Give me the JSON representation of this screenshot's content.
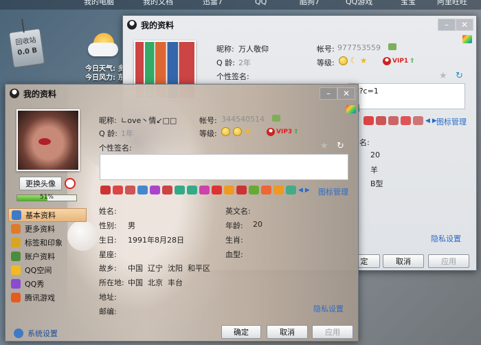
{
  "desktop": {
    "top_items": [
      "我的电脑",
      "我的文档",
      "迅雷7",
      "QQ",
      "酷狗7",
      "QQ游戏",
      "宝宝",
      "阿里旺旺"
    ],
    "trash_label": "回收站",
    "trash_size": "0.0 B",
    "weather_today_label": "今日天气:",
    "weather_today_value": "多",
    "weather_wind_label": "今日风力:",
    "weather_wind_value": "东"
  },
  "back_window": {
    "title": "我的资料",
    "nickname_label": "昵称:",
    "nickname_value": "万人敬仰",
    "account_label": "帐号:",
    "account_value": "977753559",
    "qage_label": "Q 龄:",
    "qage_value": "2年",
    "level_label": "等级:",
    "vip_text": "VIP1",
    "signature_label": "个性签名:",
    "signature_value": "m?c=1",
    "icon_manage": "图标管理",
    "name_label": "名:",
    "age_value": "20",
    "zodiac_value": "羊",
    "blood_value": "B型",
    "privacy": "隐私设置",
    "ok": "定",
    "cancel": "取消",
    "apply": "应用"
  },
  "front_window": {
    "title": "我的资料",
    "change_avatar": "更换头像",
    "progress_percent": 51,
    "progress_text": "51%",
    "nickname_label": "昵称:",
    "nickname_value": "∟ove丶情↙□□",
    "account_label": "帐号:",
    "account_value": "344540514",
    "qage_label": "Q 龄:",
    "qage_value": "1年",
    "level_label": "等级:",
    "vip_text": "VIP3",
    "signature_label": "个性签名:",
    "icon_manage": "图标管理",
    "sidebar": [
      {
        "label": "基本资料",
        "icon": "profile-card-icon",
        "color": "#3f7ac8",
        "active": true
      },
      {
        "label": "更多资料",
        "icon": "more-info-icon",
        "color": "#e07a2a",
        "active": false
      },
      {
        "label": "标签和印象",
        "icon": "tag-icon",
        "color": "#d9a421",
        "active": false
      },
      {
        "label": "账户资料",
        "icon": "account-icon",
        "color": "#4b8d3f",
        "active": false
      },
      {
        "label": "QQ空间",
        "icon": "qzone-icon",
        "color": "#f2b922",
        "active": false
      },
      {
        "label": "QQ秀",
        "icon": "qqshow-icon",
        "color": "#8a4bd0",
        "active": false
      },
      {
        "label": "腾讯游戏",
        "icon": "game-icon",
        "color": "#e75a20",
        "active": false
      }
    ],
    "system_settings": "系统设置",
    "fields": {
      "name_label": "姓名:",
      "name_value": "",
      "english_name_label": "英文名:",
      "english_name_value": "",
      "gender_label": "性别:",
      "gender_value": "男",
      "age_label": "年龄:",
      "age_value": "20",
      "birthday_label": "生日:",
      "birthday_value": "1991年8月28日",
      "zodiac_label": "生肖:",
      "constellation_label": "星座:",
      "blood_label": "血型:",
      "hometown_label": "故乡:",
      "hometown_value": "中国  辽宁  沈阳  和平区",
      "location_label": "所在地:",
      "location_value": "中国  北京  丰台",
      "address_label": "地址:",
      "email_label": "邮编:"
    },
    "privacy": "隐私设置",
    "ok": "确定",
    "cancel": "取消",
    "apply": "应用"
  }
}
